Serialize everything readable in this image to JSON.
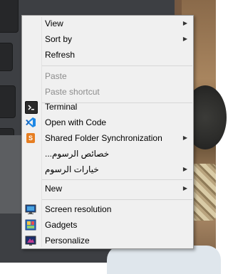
{
  "context_menu": {
    "items": [
      {
        "label": "View",
        "has_submenu": true,
        "enabled": true
      },
      {
        "label": "Sort by",
        "has_submenu": true,
        "enabled": true
      },
      {
        "label": "Refresh",
        "has_submenu": false,
        "enabled": true
      },
      {
        "label": "Paste",
        "has_submenu": false,
        "enabled": false
      },
      {
        "label": "Paste shortcut",
        "has_submenu": false,
        "enabled": false
      },
      {
        "label": "Terminal",
        "has_submenu": false,
        "enabled": true,
        "icon": "terminal-icon"
      },
      {
        "label": "Open with Code",
        "has_submenu": false,
        "enabled": true,
        "icon": "vscode-icon"
      },
      {
        "label": "Shared Folder Synchronization",
        "has_submenu": true,
        "enabled": true,
        "icon": "sync-icon"
      },
      {
        "label": "خصائص الرسوم...",
        "has_submenu": false,
        "enabled": true
      },
      {
        "label": "خيارات الرسوم",
        "has_submenu": true,
        "enabled": true
      },
      {
        "label": "New",
        "has_submenu": true,
        "enabled": true
      },
      {
        "label": "Screen resolution",
        "has_submenu": false,
        "enabled": true,
        "icon": "monitor-icon"
      },
      {
        "label": "Gadgets",
        "has_submenu": false,
        "enabled": true,
        "icon": "gadgets-icon"
      },
      {
        "label": "Personalize",
        "has_submenu": false,
        "enabled": true,
        "icon": "personalize-icon"
      }
    ],
    "submenu_arrow": "▶"
  },
  "colors": {
    "menu_background": "#f0f0f0",
    "menu_border": "#979797",
    "disabled_text": "#8c8c8c",
    "vscode_blue": "#1e88e5",
    "sync_orange": "#e67e22"
  }
}
